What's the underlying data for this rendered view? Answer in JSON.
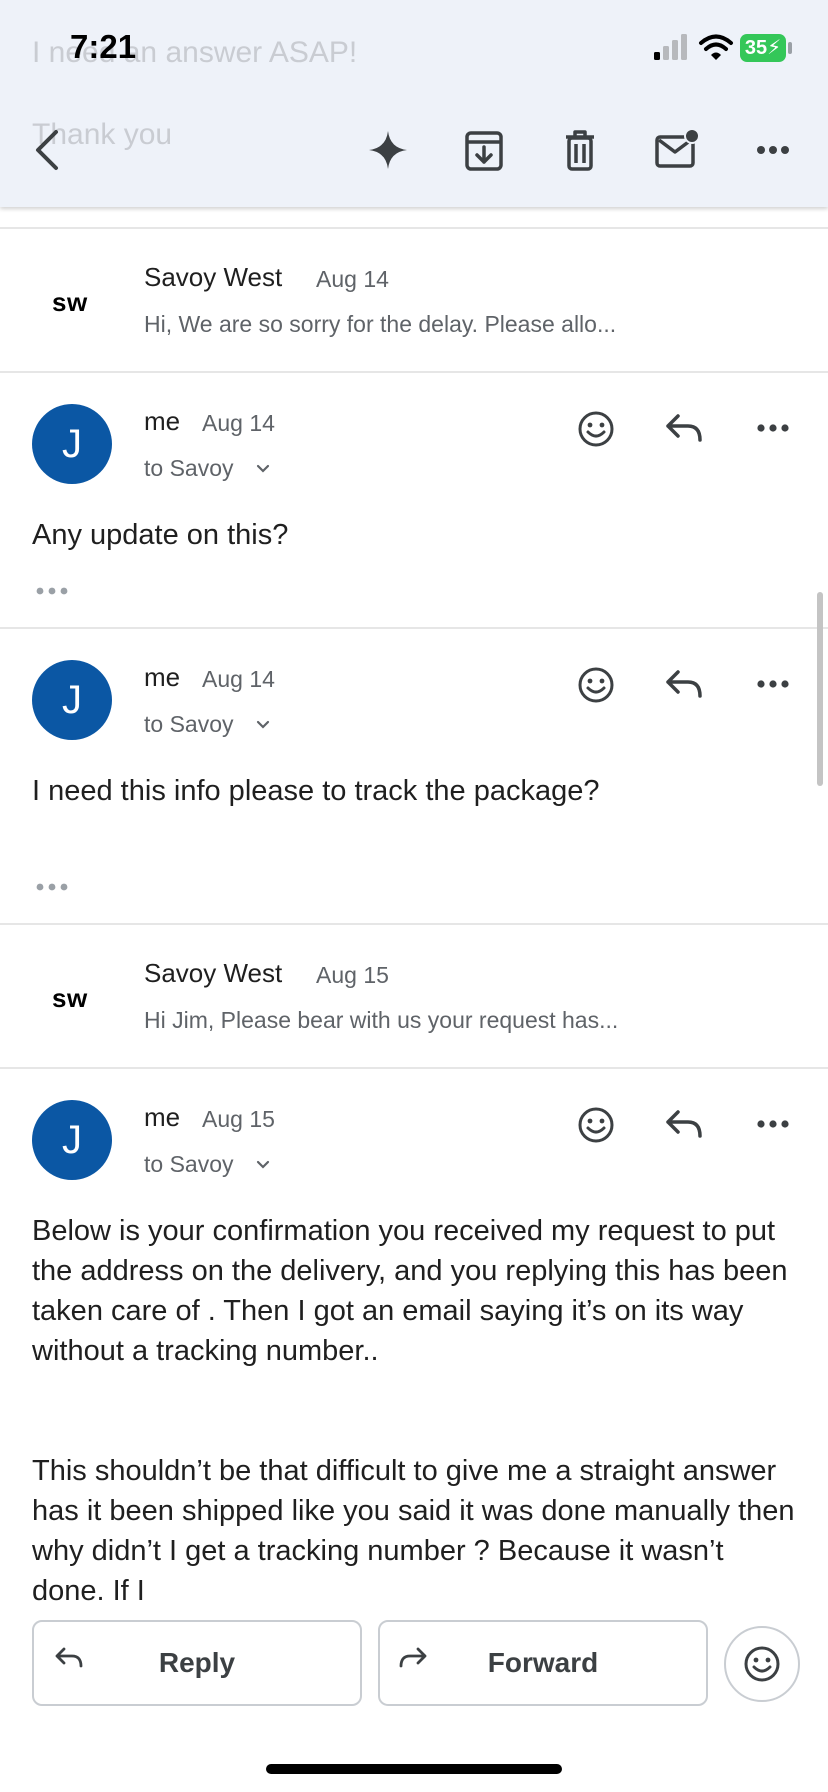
{
  "status_bar": {
    "time": "7:21",
    "battery": "35"
  },
  "background_text": {
    "line1": "I need an answer ASAP!",
    "line2": "Thank you"
  },
  "toolbar": {
    "icons": [
      "back-icon",
      "sparkle-icon",
      "archive-icon",
      "trash-icon",
      "mark-unread-icon",
      "more-icon"
    ]
  },
  "messages": [
    {
      "type": "collapsed",
      "sender_logo": "sw",
      "sender": "Savoy West",
      "date": "Aug 14",
      "snippet": "Hi, We are so sorry for the delay. Please allo..."
    },
    {
      "type": "expanded",
      "avatar": "J",
      "sender": "me",
      "date": "Aug 14",
      "to": "to Savoy",
      "body": "Any update on this?"
    },
    {
      "type": "expanded",
      "avatar": "J",
      "sender": "me",
      "date": "Aug 14",
      "to": "to Savoy",
      "body": "I need this info please to track the package?"
    },
    {
      "type": "collapsed",
      "sender_logo": "sw",
      "sender": "Savoy West",
      "date": "Aug 15",
      "snippet": "Hi Jim, Please bear with us your request has..."
    },
    {
      "type": "expanded",
      "avatar": "J",
      "sender": "me",
      "date": "Aug 15",
      "to": "to Savoy",
      "body_p1": "Below is your confirmation you received my request to put the address on the delivery, and you replying this has been taken care of . Then I got an email saying it’s on its way without a tracking number..",
      "body_p2": "This shouldn’t be that difficult to give me a straight answer has it been shipped like you said it was done manually then why didn’t I get a tracking number ? Because it wasn’t done. If I"
    }
  ],
  "actions": {
    "reply_label": "Reply",
    "forward_label": "Forward"
  },
  "colors": {
    "avatar": "#0b57a4",
    "header_bg": "#eef2f9",
    "battery": "#34c759"
  }
}
